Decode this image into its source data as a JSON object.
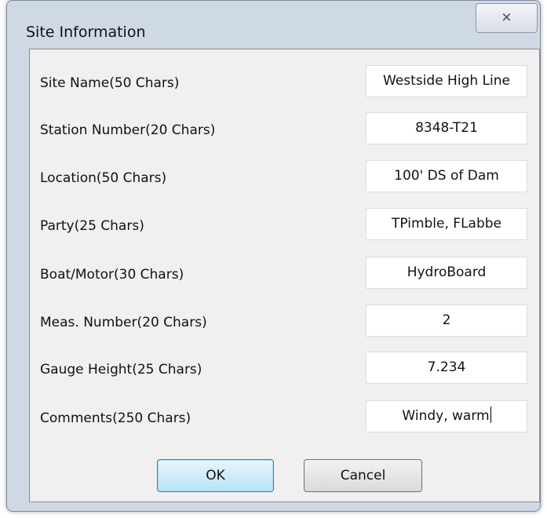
{
  "window": {
    "title": "Site Information",
    "close_glyph": "✕"
  },
  "fields": [
    {
      "label": "Site Name(50 Chars)",
      "value": "Westside High Line"
    },
    {
      "label": "Station Number(20 Chars)",
      "value": "8348-T21"
    },
    {
      "label": "Location(50 Chars)",
      "value": "100' DS of Dam"
    },
    {
      "label": "Party(25 Chars)",
      "value": "TPimble, FLabbe"
    },
    {
      "label": "Boat/Motor(30 Chars)",
      "value": "HydroBoard"
    },
    {
      "label": "Meas. Number(20 Chars)",
      "value": "2"
    },
    {
      "label": "Gauge Height(25 Chars)",
      "value": "7.234"
    },
    {
      "label": "Comments(250 Chars)",
      "value": "Windy, warm"
    }
  ],
  "buttons": {
    "ok_label": "OK",
    "cancel_label": "Cancel"
  },
  "colors": {
    "window_frame": "#cfd9e6",
    "client_bg": "#f0f0f0",
    "ok_button_accent": "#b8e1f8"
  }
}
